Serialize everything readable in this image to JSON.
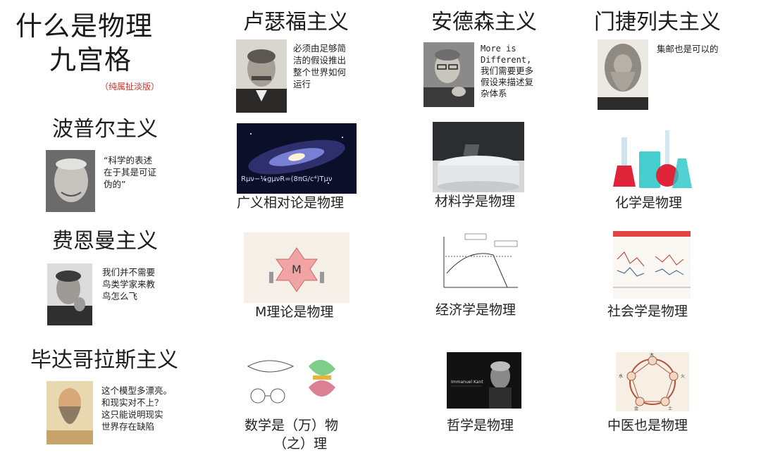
{
  "title": {
    "line1": "什么是物理",
    "line2": "九宫格",
    "note": "（纯属扯淡版）"
  },
  "columns": {
    "rutherford": {
      "heading": "卢瑟福主义",
      "quote": [
        "必须由足够简",
        "洁的假设推出",
        "整个世界如何",
        "运行"
      ]
    },
    "anderson": {
      "heading": "安德森主义",
      "quote": [
        "More is",
        "Different,",
        "我们需要更多",
        "假设来描述复",
        "杂体系"
      ]
    },
    "mendeleev": {
      "heading": "门捷列夫主义",
      "quote": [
        "集邮也是可以的"
      ]
    }
  },
  "rows": {
    "popper": {
      "heading": "波普尔主义",
      "quote": [
        "“科学的表述",
        "在于其是可证",
        "伪的”"
      ]
    },
    "feynman": {
      "heading": "费恩曼主义",
      "quote": [
        "我们并不需要",
        "鸟类学家来教",
        "鸟怎么飞"
      ]
    },
    "pythagoras": {
      "heading": "毕达哥拉斯主义",
      "quote": [
        "这个模型多漂亮。",
        "和现实对不上？",
        "这只能说明现实",
        "世界存在缺陷"
      ]
    }
  },
  "cells": {
    "r1c1": {
      "caption": "广义相对论是物理",
      "formula": "Rμν−½gμνR=(8πG/c⁴)Tμν"
    },
    "r1c2": {
      "caption": "材料学是物理"
    },
    "r1c3": {
      "caption": "化学是物理"
    },
    "r2c1": {
      "caption": "M理论是物理",
      "center_label": "M"
    },
    "r2c2": {
      "caption": "经济学是物理"
    },
    "r2c3": {
      "caption": "社会学是物理"
    },
    "r3c1": {
      "caption_line1": "数学是（万）物",
      "caption_line2": "（之）理"
    },
    "r3c2": {
      "caption": "哲学是物理",
      "slide_text": "Immanuel Kant"
    },
    "r3c3": {
      "caption": "中医也是物理",
      "elements": [
        "木",
        "火",
        "土",
        "金",
        "水"
      ]
    }
  },
  "colors": {
    "note_red": "#d0302a",
    "galaxy_bg": "#0b0f2a",
    "chem_red": "#e0253a",
    "chem_teal": "#26c6c6"
  }
}
